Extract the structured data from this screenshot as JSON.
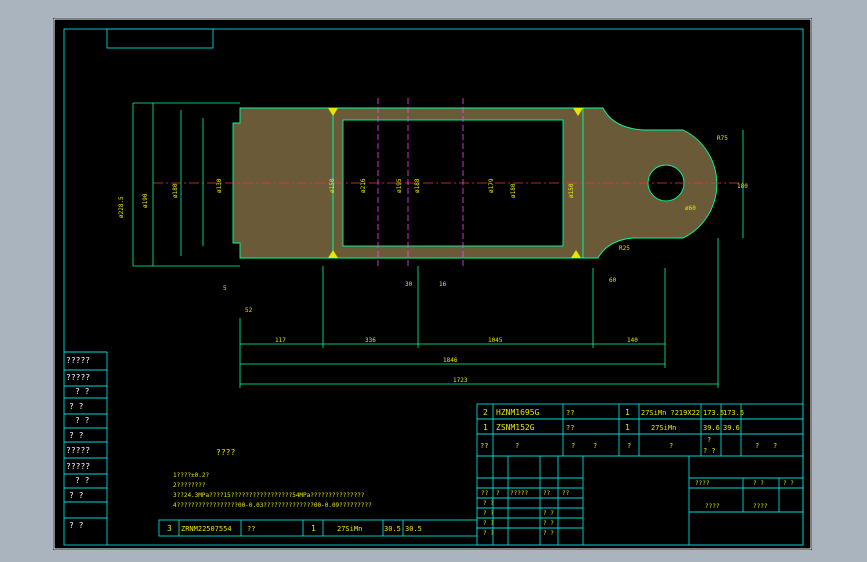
{
  "drawing": {
    "parts_table": [
      {
        "no": "2",
        "code": "HZNM1695G",
        "name": "??",
        "qty": "1",
        "material": "27SiMn  ?219X22",
        "w1": "173.5",
        "w2": "173.5"
      },
      {
        "no": "1",
        "code": "ZSNM152G",
        "name": "??",
        "qty": "1",
        "material": "27SiMn",
        "w1": "39.6",
        "w2": "39.6"
      }
    ],
    "bottom_part": {
      "no": "3",
      "code": "ZRNM22507554",
      "name": "??",
      "qty": "1",
      "material": "27SiMn",
      "w1": "30.5",
      "w2": "30.5"
    },
    "header_labels": [
      "??",
      "?",
      "?",
      "?",
      "?",
      "?",
      "?",
      "1 ?",
      "?",
      "?"
    ],
    "header_sub": "? ?",
    "notes_title": "????",
    "notes": [
      "1????±0.2?",
      "2????????",
      "3??24.3MPa????15?????????????????54MPa???????????????",
      "4?????????????????00-0.03??????????????00-0.09?????????"
    ],
    "left_column": [
      "?????",
      "?????",
      "? ?",
      "? ?",
      "? ?",
      "? ?",
      "?????",
      "?????",
      "? ?",
      "? ?",
      "? ?"
    ],
    "title_block": {
      "row_labels": [
        "? ?",
        "? ?",
        "? ?",
        "? ?",
        "? ?"
      ],
      "sig_cells": [
        "??",
        "?",
        "?????",
        "??",
        "??"
      ],
      "right_labels": [
        "????",
        "? ?",
        "? ?",
        "? ?",
        "? ?",
        "????",
        "????"
      ]
    },
    "dimensions": {
      "d1": "ø228.5",
      "d2": "ø190",
      "d3": "ø180",
      "d4": "ø130",
      "d5": "ø150",
      "d6": "ø216",
      "d7": "ø195",
      "d8": "ø188",
      "d9": "ø179",
      "d10": "ø180",
      "d11": "ø150",
      "r1": "R75",
      "r2": "ø60",
      "h1": "180",
      "a1": "5",
      "a2": "52",
      "a3": "117",
      "a4": "336",
      "a5": "1045",
      "a6": "140",
      "a7": "1846",
      "a8": "1723",
      "a9": "30",
      "a10": "16",
      "a11": "R25",
      "a12": "60"
    }
  }
}
